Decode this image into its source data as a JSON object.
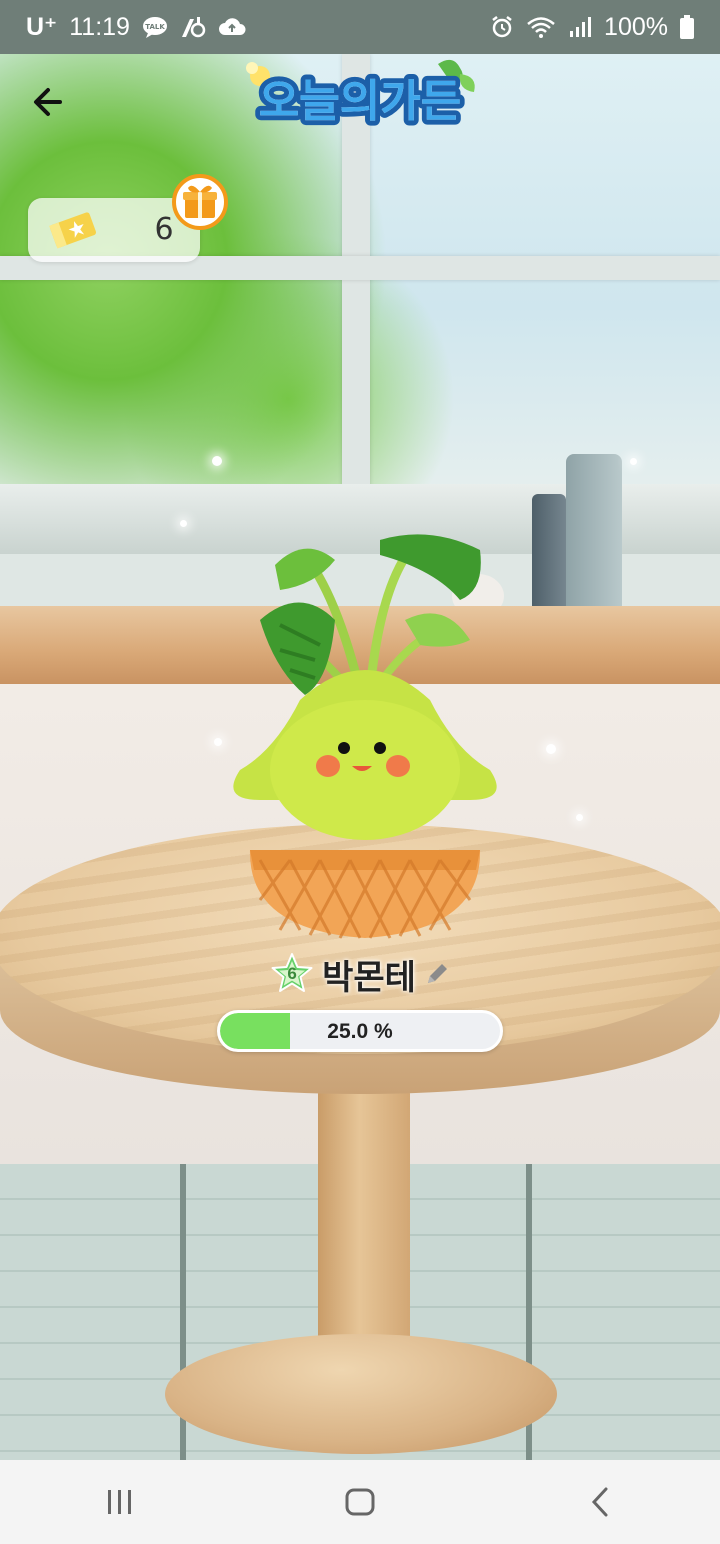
{
  "status_bar": {
    "carrier": "U⁺",
    "time": "11:19",
    "notif_icons": [
      "talk-icon",
      "vpn-key-icon",
      "cloud-icon"
    ],
    "status_icons": [
      "alarm-icon",
      "wifi-icon",
      "signal-icon"
    ],
    "battery": "100%"
  },
  "header": {
    "logo_text": "오늘의가든",
    "back_icon": "back-arrow-icon"
  },
  "tickets": {
    "count": "6",
    "icon": "ticket-icon"
  },
  "gift": {
    "icon": "gift-icon"
  },
  "plant": {
    "level": "6",
    "name": "박몬테",
    "edit_icon": "pencil-icon"
  },
  "progress": {
    "value": 0.25,
    "label": "25.0 %",
    "fill_color": "#78e05f"
  },
  "navbar": {
    "items": [
      "recents-icon",
      "home-icon",
      "back-icon"
    ]
  },
  "colors": {
    "status_bar": "#6f7e78",
    "accent_orange": "#f39a1a",
    "logo_blue": "#2f8fd8"
  }
}
